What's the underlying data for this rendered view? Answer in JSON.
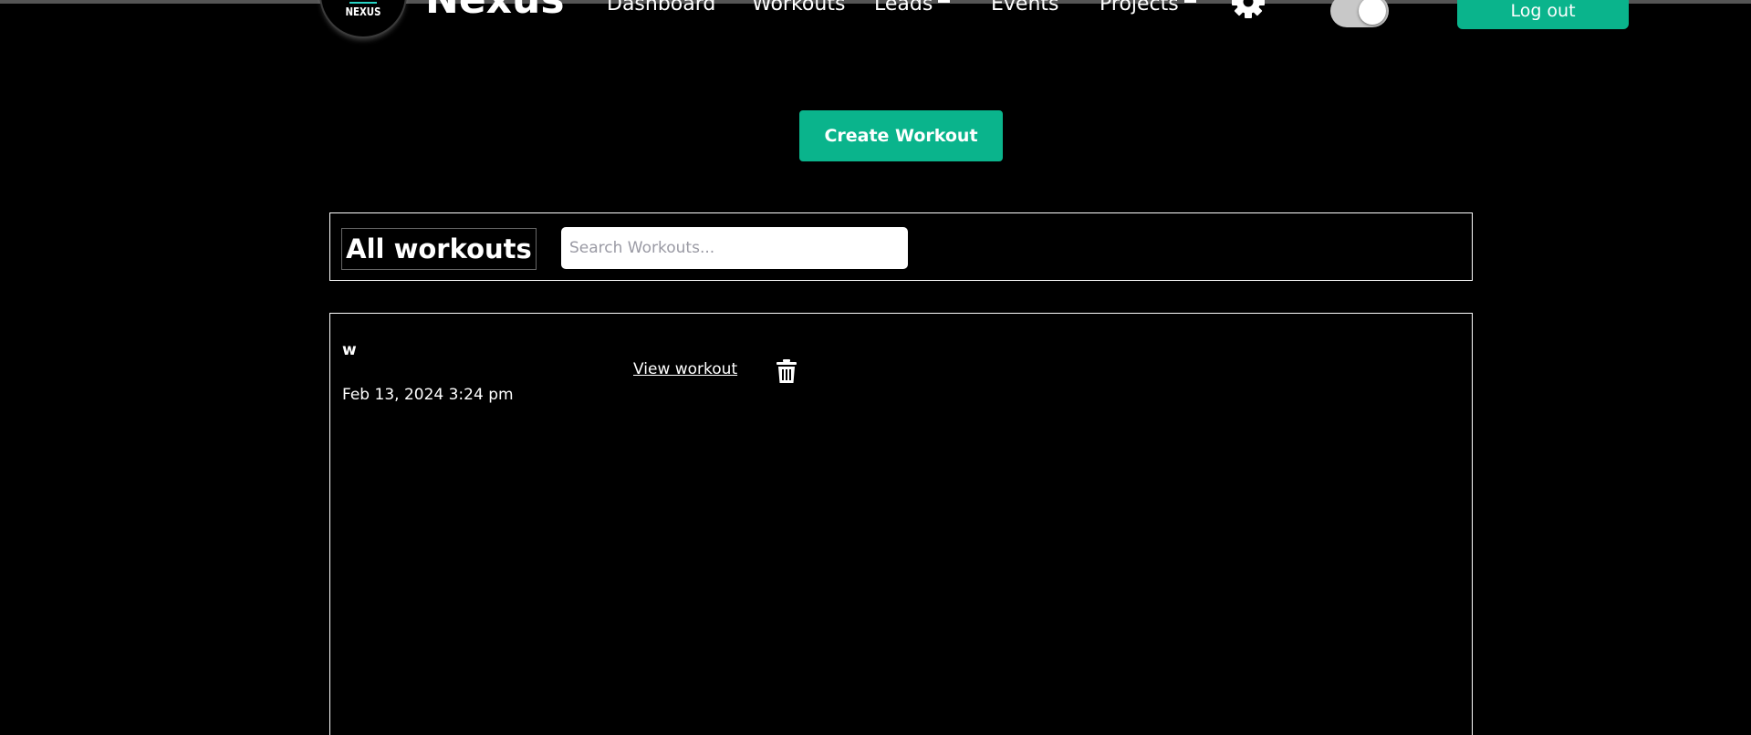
{
  "header": {
    "logo_text": "NEXUS",
    "brand": "Nexus",
    "nav": {
      "dashboard": "Dashboard",
      "workouts": "Workouts",
      "leads": "Leads",
      "events": "Events",
      "projects": "Projects"
    },
    "icons": {
      "settings": "gear-icon",
      "theme_toggle": "toggle-switch",
      "leads_caret": "caret-icon",
      "projects_caret": "caret-icon"
    },
    "logout_label": "Log out"
  },
  "actions": {
    "create_label": "Create Workout"
  },
  "toolbar": {
    "title": "All workouts",
    "search_placeholder": "Search Workouts..."
  },
  "workouts": [
    {
      "name": "w",
      "date": "Feb 13, 2024 3:24 pm",
      "view_label": "View workout",
      "delete_icon": "trash-icon"
    }
  ],
  "colors": {
    "background": "#000000",
    "accent": "#0ab48c",
    "text": "#ffffff",
    "logo_accent": "#27d3c4"
  }
}
